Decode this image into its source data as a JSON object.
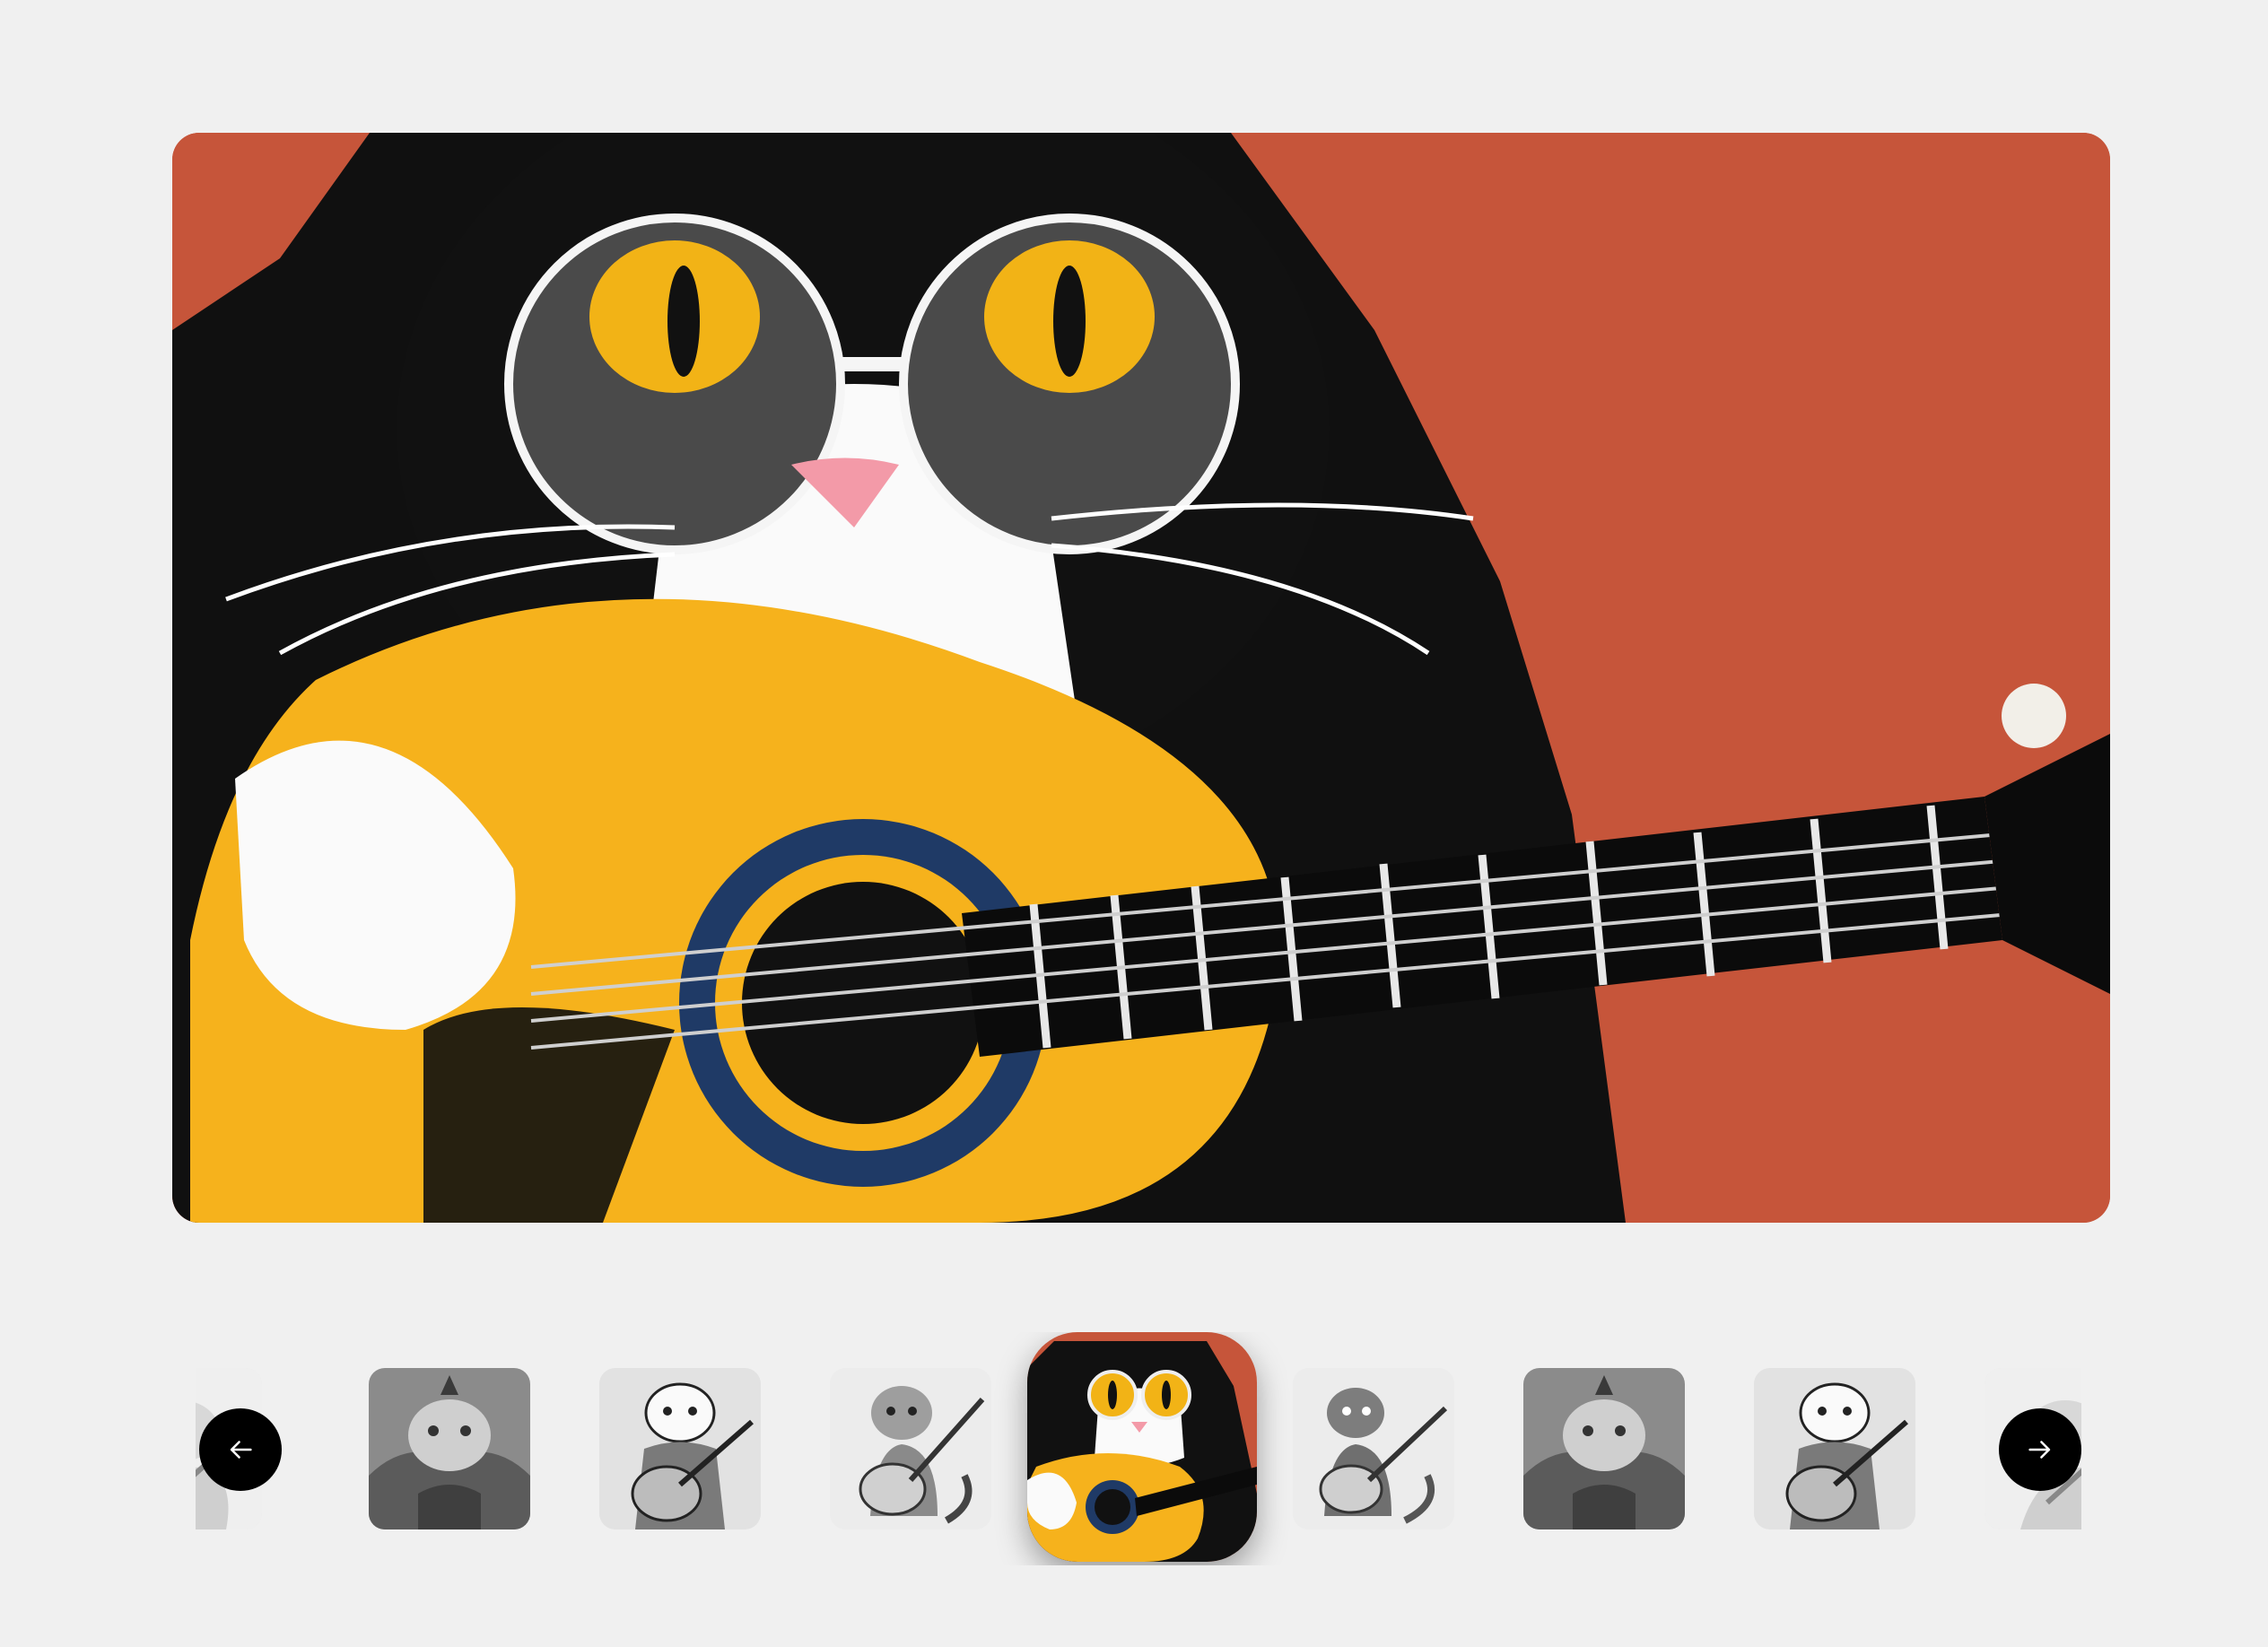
{
  "gallery": {
    "main_image": {
      "icon": "cat-playing-guitar-illustration",
      "colors": {
        "background": "#c6553a",
        "guitar": "#f6b21c",
        "fur": "#111111"
      }
    },
    "thumbnails": [
      {
        "icon": "cat-guitar-sketch-thumbnail",
        "active": false
      },
      {
        "icon": "crowned-cat-portrait-thumbnail",
        "active": false
      },
      {
        "icon": "cat-kimono-guitar-thumbnail",
        "active": false
      },
      {
        "icon": "tabby-cat-guitar-thumbnail",
        "active": false
      },
      {
        "icon": "cat-glasses-guitar-thumbnail",
        "active": true
      },
      {
        "icon": "cat-guitar-sketch-thumbnail",
        "active": false
      },
      {
        "icon": "crowned-cat-portrait-thumbnail",
        "active": false
      },
      {
        "icon": "cat-kimono-guitar-thumbnail",
        "active": false
      },
      {
        "icon": "cat-guitar-sketch-thumbnail",
        "active": false
      }
    ],
    "controls": {
      "prev_icon": "arrow-left-icon",
      "next_icon": "arrow-right-icon"
    }
  }
}
